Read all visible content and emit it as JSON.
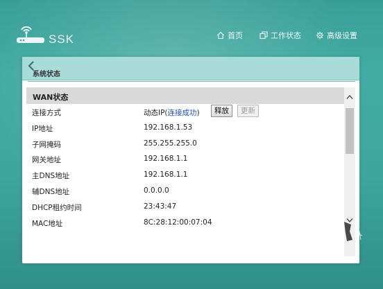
{
  "brand": {
    "name": "SSK"
  },
  "nav": {
    "home": "首页",
    "work_status": "工作状态",
    "advanced_settings": "高级设置"
  },
  "panel": {
    "title": "系统状态",
    "section_title": "WAN状态"
  },
  "wan_rows": [
    {
      "label": "连接方式",
      "value": "动态IP(",
      "link": "连接成功",
      "suffix": ")"
    },
    {
      "label": "IP地址",
      "value": "192.168.1.53"
    },
    {
      "label": "子网掩码",
      "value": "255.255.255.0"
    },
    {
      "label": "网关地址",
      "value": "192.168.1.1"
    },
    {
      "label": "主DNS地址",
      "value": "192.168.1.1"
    },
    {
      "label": "辅DNS地址",
      "value": "0.0.0.0"
    },
    {
      "label": "DHCP租约时间",
      "value": "23:43:47"
    },
    {
      "label": "MAC地址",
      "value": "8C:28:12:00:07:04"
    }
  ],
  "buttons": {
    "release": "释放",
    "renew": "更新"
  },
  "icons": {
    "logo": "router-antenna-icon",
    "home": "home-icon",
    "status": "status-window-icon",
    "settings": "gear-icon",
    "back": "chevron-left-icon"
  },
  "colors": {
    "background": "#3ea69e",
    "header_bar": "#a9dcd8",
    "section_bar": "#d9d9d9",
    "link": "#1b4fc2"
  }
}
